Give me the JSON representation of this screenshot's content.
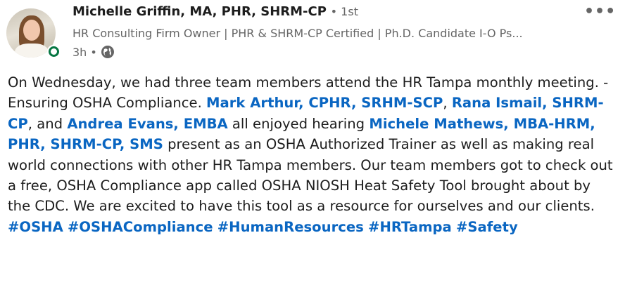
{
  "author": {
    "name": "Michelle Griffin, MA, PHR, SHRM-CP",
    "degree": "• 1st",
    "headline": "HR Consulting Firm Owner | PHR & SHRM-CP Certified | Ph.D. Candidate I-O Ps...",
    "time": "3h •",
    "avatar": "profile-photo",
    "status_color": "#057642"
  },
  "menu": {
    "more_label": "•••"
  },
  "post": {
    "text_1": "On Wednesday, we had three team members attend the HR Tampa monthly meeting. - Ensuring OSHA Compliance. ",
    "mention_1": "Mark Arthur, CPHR, SRHM-SCP",
    "text_2": ", ",
    "mention_2": "Rana Ismail, SHRM-CP",
    "text_3": ", and ",
    "mention_3": "Andrea Evans, EMBA",
    "text_4": " all enjoyed hearing ",
    "mention_4": "Michele Mathews, MBA-HRM, PHR, SHRM-CP, SMS",
    "text_5": " present as an OSHA Authorized Trainer as well as making real world connections with other HR Tampa members. Our team members got to check out a free, OSHA Compliance app called OSHA NIOSH Heat Safety Tool brought about by the CDC. We are excited to have this tool as a resource for ourselves and our clients.",
    "hashtags": [
      "#OSHA",
      "#OSHACompliance",
      "#HumanResources",
      "#HRTampa",
      "#Safety"
    ]
  },
  "colors": {
    "link": "#0a66c2",
    "text": "#1d1d1d",
    "muted": "#666666"
  }
}
